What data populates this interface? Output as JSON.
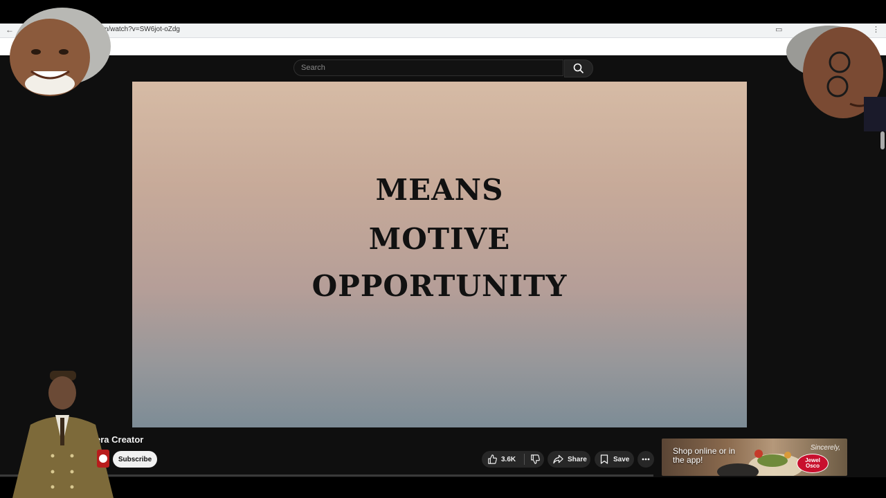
{
  "browser": {
    "url": "m/watch?v=SW6jot-oZdg"
  },
  "search": {
    "placeholder": "Search"
  },
  "video": {
    "lines": [
      "MEANS",
      "MOTIVE",
      "OPPORTUNITY"
    ]
  },
  "channel": {
    "name": "era Creator",
    "subscribe_label": "Subscribe"
  },
  "actions": {
    "like_count": "3.6K",
    "share_label": "Share",
    "save_label": "Save"
  },
  "ad": {
    "text": "Shop online or in the app!",
    "tagline": "Sincerely,",
    "logo": "Jewel Osco"
  },
  "colors": {
    "page_bg": "#0f0f0f",
    "pill_bg": "#272727",
    "brand_red": "#c8102e"
  },
  "icons": [
    "back-icon",
    "search-icon",
    "like-icon",
    "dislike-icon",
    "share-icon",
    "save-icon",
    "more-icon"
  ]
}
